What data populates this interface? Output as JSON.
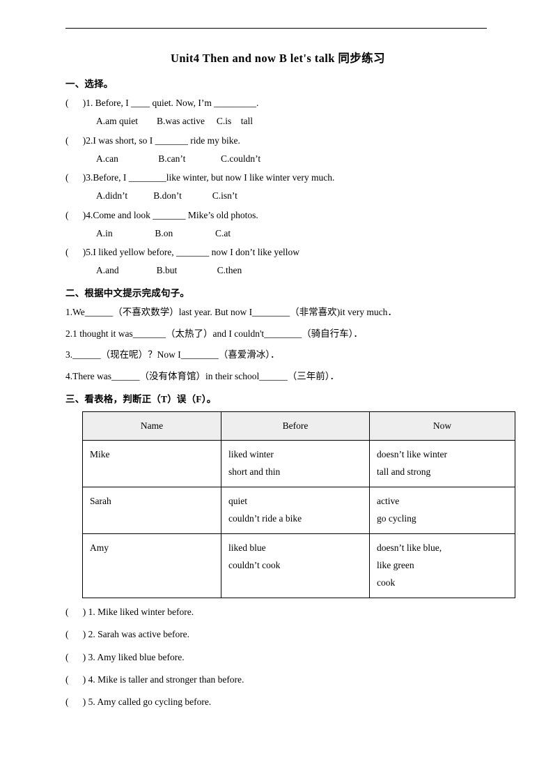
{
  "title": "Unit4 Then and now B let's talk 同步练习",
  "section1": {
    "heading": "一、选择。",
    "questions": [
      {
        "stem": "(      )1. Before, I ____ quiet. Now, I’m _________.",
        "options": "A.am quiet        B.was active     C.is    tall"
      },
      {
        "stem": "(      )2.I was short, so I _______ ride my bike.",
        "options": "A.can                 B.can’t               C.couldn’t"
      },
      {
        "stem": "(      )3.Before, I ________like winter, but now I like winter very much.",
        "options": "A.didn’t           B.don’t             C.isn’t"
      },
      {
        "stem": "(      )4.Come and look _______ Mike’s old photos.",
        "options": "A.in                  B.on                  C.at"
      },
      {
        "stem": "(      )5.I liked yellow before, _______ now I don’t like yellow",
        "options": "A.and                B.but                 C.then"
      }
    ]
  },
  "section2": {
    "heading": "二、根据中文提示完成句子。",
    "items": [
      "1.We______（不喜欢数学）last year. But now I________（非常喜欢)it very much．",
      "2.1 thought it was_______（太热了）and I couldn't________（骑自行车）．",
      "3.______（现在呢）？Now I________（喜爱滑冰）．",
      "4.There was______（没有体育馆）in their school______（三年前）．"
    ]
  },
  "section3": {
    "heading": "三、看表格，判断正（T）误（F）。",
    "table": {
      "headers": [
        "Name",
        "Before",
        "Now"
      ],
      "rows": [
        {
          "name": "Mike",
          "before": [
            "liked winter",
            "short and thin"
          ],
          "now": [
            "doesn’t like winter",
            "tall and strong"
          ]
        },
        {
          "name": "Sarah",
          "before": [
            "quiet",
            "couldn’t ride a bike"
          ],
          "now": [
            "active",
            "go cycling"
          ]
        },
        {
          "name": "Amy",
          "before": [
            "liked blue",
            "couldn’t cook"
          ],
          "now": [
            "doesn’t like blue,",
            "like green",
            "cook"
          ]
        }
      ]
    },
    "tf_items": [
      "(      ) 1. Mike liked winter before.",
      "(      ) 2. Sarah was active before.",
      "(      ) 3. Amy liked blue before.",
      "(      ) 4. Mike is taller and stronger than before.",
      "(      ) 5. Amy called go cycling before."
    ]
  }
}
